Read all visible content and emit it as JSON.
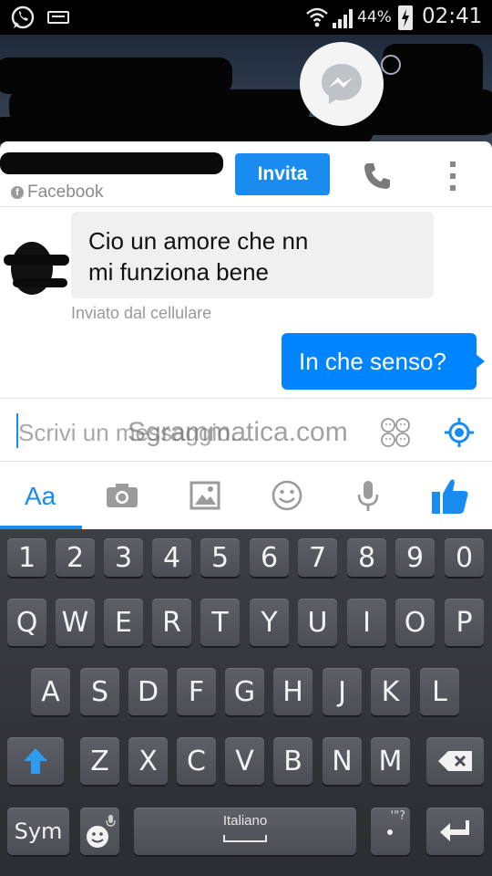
{
  "status_bar": {
    "battery_percent": "44%",
    "time": "02:41"
  },
  "header": {
    "profile_source": "Facebook",
    "invite_button": "Invita"
  },
  "messages": [
    {
      "sender": "other",
      "line1": "Cio un amore che nn",
      "line2": "mi funziona bene",
      "meta": "Inviato dal cellulare"
    },
    {
      "sender": "me",
      "text": "In che senso?"
    }
  ],
  "composer": {
    "placeholder": "Scrivi un messaggio...",
    "watermark": "Sgrammatica.com"
  },
  "toolbar": {
    "text_tab": "Aa"
  },
  "keyboard": {
    "row_numbers": [
      "1",
      "2",
      "3",
      "4",
      "5",
      "6",
      "7",
      "8",
      "9",
      "0"
    ],
    "row1": [
      "Q",
      "W",
      "E",
      "R",
      "T",
      "Y",
      "U",
      "I",
      "O",
      "P"
    ],
    "row2": [
      "A",
      "S",
      "D",
      "F",
      "G",
      "H",
      "J",
      "K",
      "L"
    ],
    "row3": [
      "Z",
      "X",
      "C",
      "V",
      "B",
      "N",
      "M"
    ],
    "sym_label": "Sym",
    "space_label": "Italiano",
    "punct_label": "'\"?"
  },
  "colors": {
    "messenger_blue": "#0084ff",
    "invite_blue": "#1a8cf0",
    "incoming_bubble": "#f1f0f0",
    "keyboard_bg": "#2b2d31",
    "shift_blue": "#2e9bf0"
  }
}
